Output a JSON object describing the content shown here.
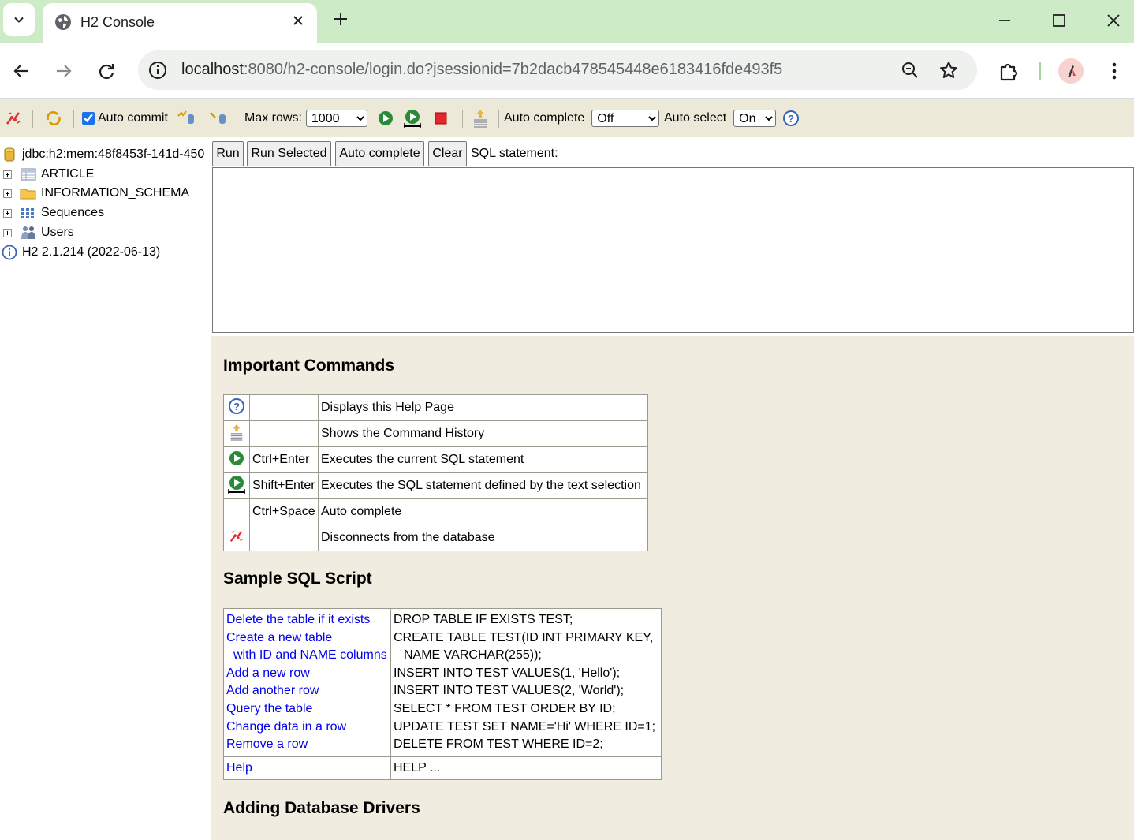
{
  "browser": {
    "tab_title": "H2 Console",
    "url_host": "localhost",
    "url_rest": ":8080/h2-console/login.do?jsessionid=7b2dacb478545448e6183416fde493f5"
  },
  "h2_toolbar": {
    "auto_commit_label": "Auto commit",
    "max_rows_label": "Max rows:",
    "max_rows_value": "1000",
    "auto_complete_label": "Auto complete",
    "auto_complete_value": "Off",
    "auto_select_label": "Auto select",
    "auto_select_value": "On"
  },
  "tree": {
    "connection": "jdbc:h2:mem:48f8453f-141d-450",
    "items": [
      {
        "label": "ARTICLE",
        "icon": "table-icon"
      },
      {
        "label": "INFORMATION_SCHEMA",
        "icon": "folder-icon"
      },
      {
        "label": "Sequences",
        "icon": "sequences-icon"
      },
      {
        "label": "Users",
        "icon": "users-icon"
      }
    ],
    "version": "H2 2.1.214 (2022-06-13)"
  },
  "query": {
    "run": "Run",
    "run_selected": "Run Selected",
    "auto_complete": "Auto complete",
    "clear": "Clear",
    "sql_label": "SQL statement:"
  },
  "help": {
    "important_title": "Important Commands",
    "commands": [
      {
        "icon": "help-icon",
        "key": "",
        "desc": "Displays this Help Page"
      },
      {
        "icon": "history-icon",
        "key": "",
        "desc": "Shows the Command History"
      },
      {
        "icon": "run-icon",
        "key": "Ctrl+Enter",
        "desc": "Executes the current SQL statement"
      },
      {
        "icon": "run-selected-icon",
        "key": "Shift+Enter",
        "desc": "Executes the SQL statement defined by the text selection"
      },
      {
        "icon": "",
        "key": "Ctrl+Space",
        "desc": "Auto complete"
      },
      {
        "icon": "disconnect-icon",
        "key": "",
        "desc": "Disconnects from the database"
      }
    ],
    "sample_title": "Sample SQL Script",
    "sample": [
      {
        "link": "Delete the table if it exists",
        "sql": "DROP TABLE IF EXISTS TEST;"
      },
      {
        "link": "Create a new table",
        "sql": "CREATE TABLE TEST(ID INT PRIMARY KEY,"
      },
      {
        "link": "  with ID and NAME columns",
        "sql": "   NAME VARCHAR(255));"
      },
      {
        "link": "Add a new row",
        "sql": "INSERT INTO TEST VALUES(1, 'Hello');"
      },
      {
        "link": "Add another row",
        "sql": "INSERT INTO TEST VALUES(2, 'World');"
      },
      {
        "link": "Query the table",
        "sql": "SELECT * FROM TEST ORDER BY ID;"
      },
      {
        "link": "Change data in a row",
        "sql": "UPDATE TEST SET NAME='Hi' WHERE ID=1;"
      },
      {
        "link": "Remove a row",
        "sql": "DELETE FROM TEST WHERE ID=2;"
      }
    ],
    "help_link": "Help",
    "help_sql": "HELP ...",
    "drivers_title": "Adding Database Drivers"
  }
}
